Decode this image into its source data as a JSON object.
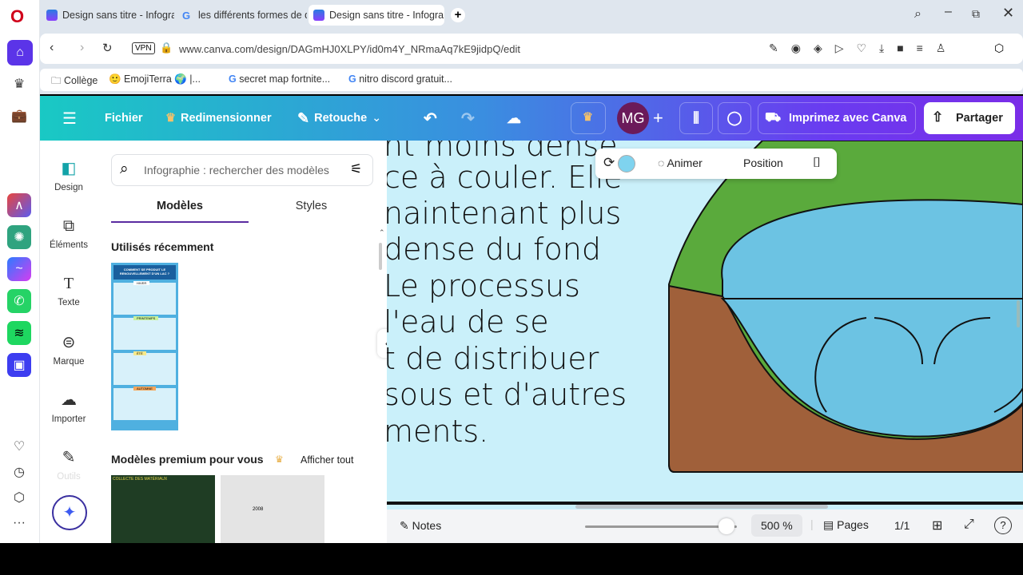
{
  "browser": {
    "tabs": [
      {
        "title": "Design sans titre - Infogra",
        "active": false
      },
      {
        "title": "les différents formes de de",
        "active": false
      },
      {
        "title": "Design sans titre - Infogra",
        "active": true
      }
    ],
    "new_tab": "+",
    "vpn": "VPN",
    "url": "www.canva.com/design/DAGmHJ0XLPY/id0m4Y_NRmaAq7kE9jidpQ/edit",
    "bookmarks": [
      "Collège",
      "EmojiTerra 🌍 |...",
      "secret map fortnite...",
      "nitro discord gratuit..."
    ]
  },
  "topbar": {
    "menu": "Fichier",
    "resize": "Redimensionner",
    "edit": "Retouche",
    "avatar": "MG",
    "print": "Imprimez avec Canva",
    "share": "Partager"
  },
  "floating_toolbar": {
    "animate": "Animer",
    "position": "Position",
    "color": "#7fd3ef"
  },
  "rail": [
    "Design",
    "Éléments",
    "Texte",
    "Marque",
    "Importer",
    "Outils"
  ],
  "panel": {
    "search_placeholder": "Infographie : rechercher des modèles",
    "tabs": [
      "Modèles",
      "Styles"
    ],
    "recent_title": "Utilisés récemment",
    "recent_thumb": {
      "title": "COMMENT SE PRODUIT LE RENOUVELLEMENT D'UN LAC ?",
      "sections": [
        "HIVER",
        "PRINTEMPS",
        "ÉTÉ",
        "AUTOMNE"
      ]
    },
    "premium_title": "Modèles premium pour vous",
    "see_all": "Afficher tout",
    "premium_thumbs": [
      {
        "caption": "COLLECTE DES MATÉRIAUX"
      },
      {
        "caption": "2008"
      }
    ]
  },
  "canvas": {
    "lines": [
      "nt moins dense",
      "ce à couler. Elle",
      "naintenant plus",
      "dense du fond",
      "Le processus",
      "l'eau de se",
      "t de distribuer",
      "sous et d'autres",
      "ments."
    ]
  },
  "bottom": {
    "notes": "Notes",
    "zoom": "500 %",
    "zoom_fraction": 0.93,
    "pages": "Pages",
    "page_count": "1/1"
  }
}
